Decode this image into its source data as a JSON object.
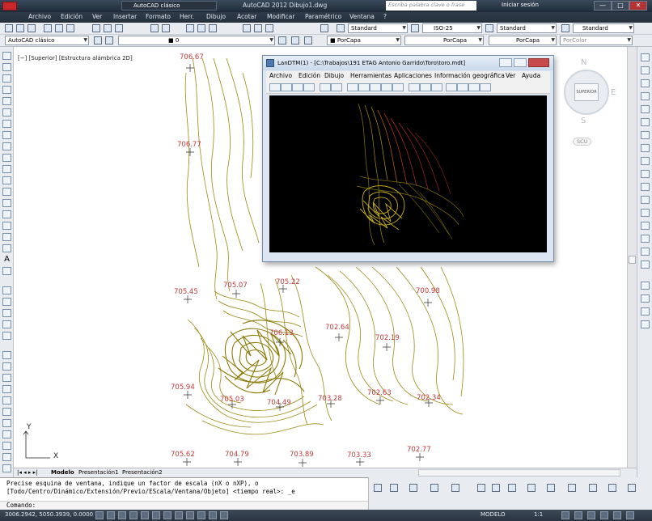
{
  "window": {
    "app_title": "AutoCAD 2012   Dibujo1.dwg",
    "workspace": "AutoCAD clásico",
    "search_placeholder": "Escriba palabra clave o frase",
    "login": "Iniciar sesión",
    "btn_min": "—",
    "btn_max": "□",
    "btn_close": "✕"
  },
  "menu": [
    "Archivo",
    "Edición",
    "Ver",
    "Insertar",
    "Formato",
    "Herr.",
    "Dibujo",
    "Acotar",
    "Modificar",
    "Paramétrico",
    "Ventana",
    "?"
  ],
  "toolbar1": {
    "text_style": "Standard",
    "dim_style": "ISO-25",
    "table_style": "Standard",
    "mleader_style": "Standard"
  },
  "toolbar2": {
    "workspace": "AutoCAD clásico",
    "layer": "0",
    "color": "PorCapa",
    "linetype": "PorCapa",
    "lineweight": "PorCapa",
    "plotstyle": "PorColor"
  },
  "viewport": {
    "label": "[−] [Superior] [Estructura alámbrica 2D]"
  },
  "viewcube": {
    "north": "N",
    "south": "S",
    "east": "E",
    "west": "O",
    "face": "SUPERIOR",
    "ucs": "SCU"
  },
  "elevations": [
    {
      "label": "706.67"
    },
    {
      "label": "706.77"
    },
    {
      "label": "705.45"
    },
    {
      "label": "705.07"
    },
    {
      "label": "705.22"
    },
    {
      "label": "700.98"
    },
    {
      "label": "702.64"
    },
    {
      "label": "702.19"
    },
    {
      "label": "706.13"
    },
    {
      "label": "705.94"
    },
    {
      "label": "705.03"
    },
    {
      "label": "704.49"
    },
    {
      "label": "703.28"
    },
    {
      "label": "702.63"
    },
    {
      "label": "702.34"
    },
    {
      "label": "705.62"
    },
    {
      "label": "704.79"
    },
    {
      "label": "703.89"
    },
    {
      "label": "703.33"
    },
    {
      "label": "702.77"
    }
  ],
  "ucs_icon": {
    "x": "X",
    "y": "Y"
  },
  "tabs": {
    "model": "Modelo",
    "layout1": "Presentación1",
    "layout2": "Presentación2"
  },
  "command": {
    "line1": "Precise esquina de ventana, indique un factor de escala (nX o nXP), o",
    "line2": "[Todo/Centro/Dinámico/Extensión/Previo/EScala/Ventana/Objeto] <tiempo real>: _e",
    "prompt": "Comando:"
  },
  "status": {
    "coords": "3006.2942, 5050.3939, 0.0000",
    "model": "MODELO",
    "scale": "1:1"
  },
  "landtm": {
    "title": "LanDTM(1) - [C:\\Trabajos\\191 ETAG Antonio Garrido\\Toro\\toro.mdt]",
    "menu": [
      "Archivo",
      "Edición",
      "Dibujo",
      "Herramientas",
      "Aplicaciones",
      "Información geográfica",
      "Ver",
      "Ayuda"
    ]
  },
  "colors": {
    "accent": "#2a3441",
    "contour": "#9a8a14",
    "elevation_text": "#c23a3a",
    "dtm_bg": "#000000"
  }
}
